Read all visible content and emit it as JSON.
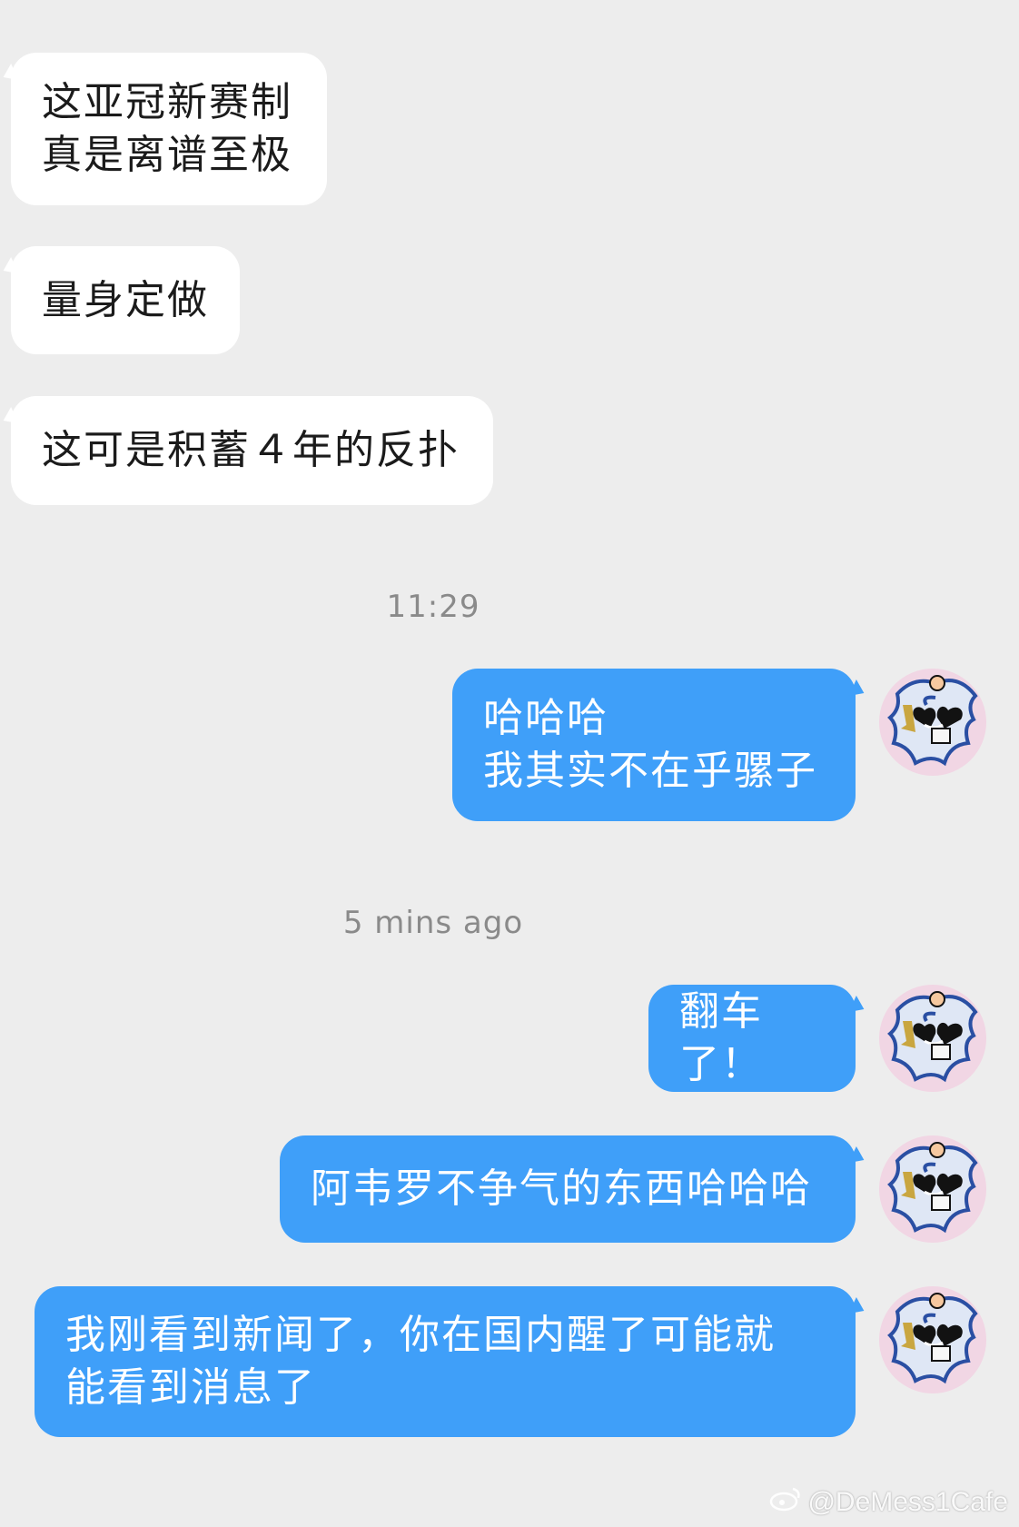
{
  "messages_in": [
    {
      "text": "这亚冠新赛制\n真是离谱至极"
    },
    {
      "text": "量身定做"
    },
    {
      "text": "这可是积蓄４年的反扑"
    }
  ],
  "timestamps": [
    "11:29",
    "5 mins ago"
  ],
  "messages_out": [
    {
      "text": "哈哈哈\n我其实不在乎骡子"
    },
    {
      "text": "翻车了！"
    },
    {
      "text": "阿韦罗不争气的东西哈哈哈"
    },
    {
      "text": "我刚看到新闻了，你在国内醒了可能就\n能看到消息了"
    }
  ],
  "avatar_icon": "user-avatar-icon",
  "watermark": {
    "text": "@DeMess1Cafe",
    "icon": "weibo-icon"
  },
  "colors": {
    "background": "#ededed",
    "incoming_bubble": "#ffffff",
    "outgoing_bubble": "#3f9ff9",
    "timestamp_text": "#8a8a8a"
  }
}
